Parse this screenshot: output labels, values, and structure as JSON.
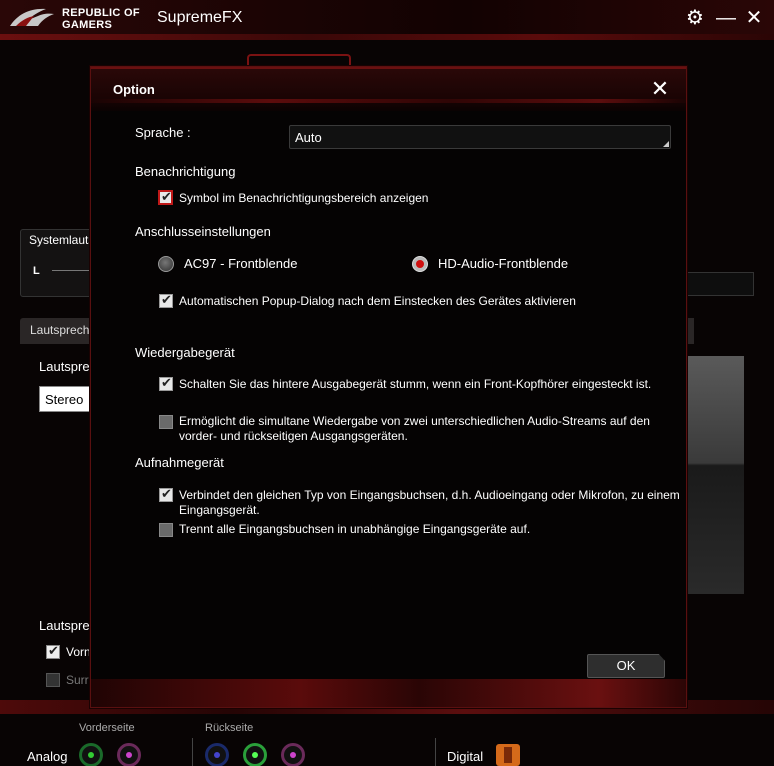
{
  "app": {
    "logo_text_line1": "REPUBLIC OF",
    "logo_text_line2": "GAMERS",
    "title": "SupremeFX"
  },
  "background": {
    "system_volume_label": "Systemlauts",
    "left_channel_label": "L",
    "speaker_tab_label": "Lautspreche",
    "speaker_config_label": "Lautspre",
    "speaker_select_value": "Stereo",
    "speaker_section_label": "Lautspre",
    "front_checkbox_label": "Vorn",
    "surround_checkbox_label": "Surro",
    "front_panel_label": "Vorderseite",
    "rear_panel_label": "Rückseite",
    "analog_label": "Analog",
    "digital_label": "Digital"
  },
  "dialog": {
    "title": "Option",
    "language_label": "Sprache :",
    "language_value": "Auto",
    "notification_heading": "Benachrichtigung",
    "notification_tray_label": "Symbol im Benachrichtigungsbereich anzeigen",
    "notification_tray_checked": true,
    "connection_heading": "Anschlusseinstellungen",
    "ac97_label": "AC97 - Frontblende",
    "hd_audio_label": "HD-Audio-Frontblende",
    "selected_front_panel": "HD-Audio-Frontblende",
    "auto_popup_label": "Automatischen Popup-Dialog nach dem Einstecken des Gerätes aktivieren",
    "auto_popup_checked": true,
    "playback_heading": "Wiedergabegerät",
    "mute_rear_label": "Schalten Sie das hintere Ausgabegerät stumm, wenn ein Front-Kopfhörer eingesteckt ist.",
    "mute_rear_checked": true,
    "multistream_label_line1": "Ermöglicht die simultane Wiedergabe von zwei unterschiedlichen Audio-Streams auf den",
    "multistream_label_line2": "vorder- und rückseitigen Ausgangsgeräten.",
    "multistream_checked": false,
    "recording_heading": "Aufnahmegerät",
    "combine_inputs_label_line1": "Verbindet den gleichen Typ von Eingangsbuchsen, d.h. Audioeingang oder Mikrofon, zu einem",
    "combine_inputs_label_line2": "Eingangsgerät.",
    "combine_inputs_checked": true,
    "separate_inputs_label": "Trennt alle Eingangsbuchsen in unabhängige Eingangsgeräte auf.",
    "separate_inputs_checked": false,
    "ok_label": "OK"
  },
  "colors": {
    "accent_red": "#c01818",
    "dialog_border": "#5a1010",
    "background": "#080404"
  }
}
